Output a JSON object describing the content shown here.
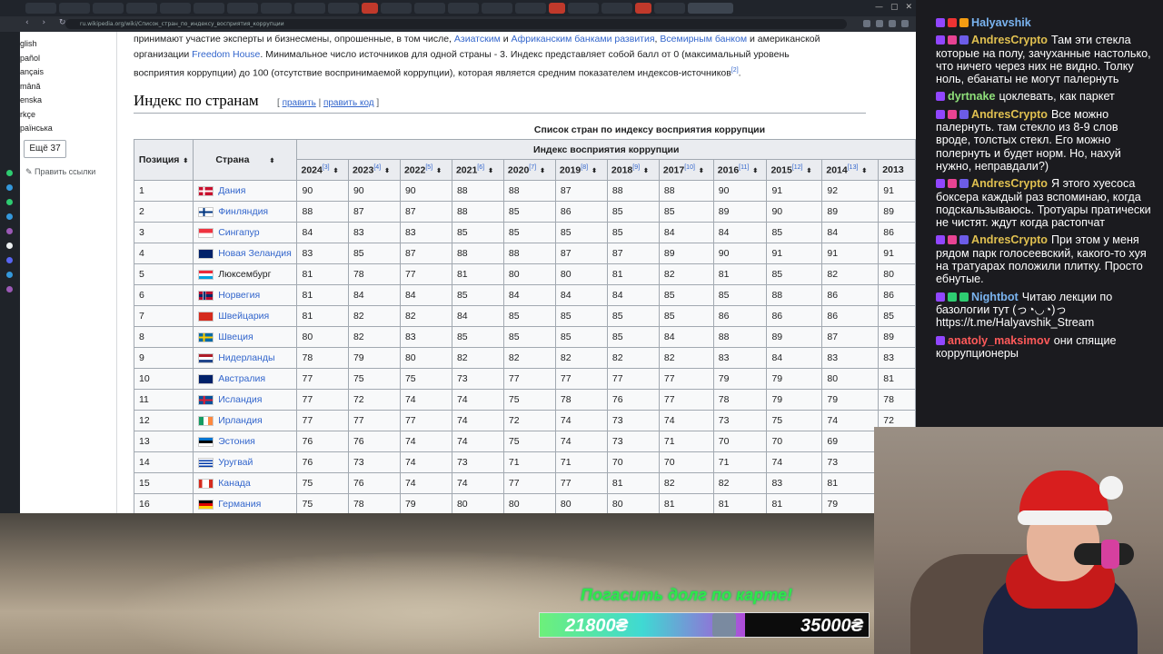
{
  "browser": {
    "url": "ru.wikipedia.org/wiki/Список_стран_по_индексу_восприятия_коррупции",
    "nav_symbols": "‹ › ↻",
    "window_controls": [
      "—",
      "▢",
      "✕"
    ]
  },
  "sidebar": {
    "languages": [
      "glish",
      "pañol",
      "ançais",
      "mână",
      "enska",
      "rkçe",
      "раїнська"
    ],
    "more_button": "Ещё 37",
    "edit_links": "Править ссылки"
  },
  "article": {
    "para_line1_pre": "принимают участие эксперты и бизнесмены, опрошенные, в том числе, ",
    "para_link1": "Азиатским",
    "para_and": " и ",
    "para_link2": "Африканским банками развития",
    "para_comma": ", ",
    "para_link3": "Всемирным банком",
    "para_line1_post": " и американской",
    "para_line2_pre": "организации ",
    "para_link4": "Freedom House",
    "para_line2_post": ". Минимальное число источников для одной страны - 3. Индекс представляет собой балл от 0 (максимальный уровень",
    "para_line3": "восприятия коррупции) до 100 (отсутствие воспринимаемой коррупции), которая является средним показателем индексов-источников",
    "para_ref": "[2]",
    "para_end": ".",
    "heading": "Индекс по странам",
    "edit_open": "[ ",
    "edit_label": "править",
    "edit_sep": " | ",
    "edit_code_label": "править код",
    "edit_close": " ]"
  },
  "table": {
    "caption": "Список стран по индексу восприятия коррупции",
    "col_position": "Позиция",
    "col_country": "Страна",
    "col_group": "Индекс восприятия коррупции",
    "sort_glyph": "⬍",
    "years": [
      {
        "year": "2024",
        "ref": "[3]"
      },
      {
        "year": "2023",
        "ref": "[4]"
      },
      {
        "year": "2022",
        "ref": "[5]"
      },
      {
        "year": "2021",
        "ref": "[6]"
      },
      {
        "year": "2020",
        "ref": "[7]"
      },
      {
        "year": "2019",
        "ref": "[8]"
      },
      {
        "year": "2018",
        "ref": "[9]"
      },
      {
        "year": "2017",
        "ref": "[10]"
      },
      {
        "year": "2016",
        "ref": "[11]"
      },
      {
        "year": "2015",
        "ref": "[12]"
      },
      {
        "year": "2014",
        "ref": "[13]"
      },
      {
        "year": "2013",
        "ref": ""
      }
    ],
    "rows": [
      {
        "pos": "1",
        "country": "Дания",
        "flag": "dk",
        "vals": [
          "90",
          "90",
          "90",
          "88",
          "88",
          "87",
          "88",
          "88",
          "90",
          "91",
          "92",
          "91"
        ]
      },
      {
        "pos": "2",
        "country": "Финляндия",
        "flag": "fi",
        "vals": [
          "88",
          "87",
          "87",
          "88",
          "85",
          "86",
          "85",
          "85",
          "89",
          "90",
          "89",
          "89"
        ]
      },
      {
        "pos": "3",
        "country": "Сингапур",
        "flag": "sg",
        "vals": [
          "84",
          "83",
          "83",
          "85",
          "85",
          "85",
          "85",
          "84",
          "84",
          "85",
          "84",
          "86"
        ]
      },
      {
        "pos": "4",
        "country": "Новая Зеландия",
        "flag": "nz",
        "vals": [
          "83",
          "85",
          "87",
          "88",
          "88",
          "87",
          "87",
          "89",
          "90",
          "91",
          "91",
          "91"
        ]
      },
      {
        "pos": "5",
        "country": "Люксембург",
        "flag": "lu",
        "vals": [
          "81",
          "78",
          "77",
          "81",
          "80",
          "80",
          "81",
          "82",
          "81",
          "85",
          "82",
          "80"
        ]
      },
      {
        "pos": "6",
        "country": "Норвегия",
        "flag": "no",
        "vals": [
          "81",
          "84",
          "84",
          "85",
          "84",
          "84",
          "84",
          "85",
          "85",
          "88",
          "86",
          "86"
        ]
      },
      {
        "pos": "7",
        "country": "Швейцария",
        "flag": "ch",
        "vals": [
          "81",
          "82",
          "82",
          "84",
          "85",
          "85",
          "85",
          "85",
          "86",
          "86",
          "86",
          "85"
        ]
      },
      {
        "pos": "8",
        "country": "Швеция",
        "flag": "se",
        "vals": [
          "80",
          "82",
          "83",
          "85",
          "85",
          "85",
          "85",
          "84",
          "88",
          "89",
          "87",
          "89"
        ]
      },
      {
        "pos": "9",
        "country": "Нидерланды",
        "flag": "nl",
        "vals": [
          "78",
          "79",
          "80",
          "82",
          "82",
          "82",
          "82",
          "82",
          "83",
          "84",
          "83",
          "83"
        ]
      },
      {
        "pos": "10",
        "country": "Австралия",
        "flag": "au",
        "vals": [
          "77",
          "75",
          "75",
          "73",
          "77",
          "77",
          "77",
          "77",
          "79",
          "79",
          "80",
          "81"
        ]
      },
      {
        "pos": "11",
        "country": "Исландия",
        "flag": "is",
        "vals": [
          "77",
          "72",
          "74",
          "74",
          "75",
          "78",
          "76",
          "77",
          "78",
          "79",
          "79",
          "78"
        ]
      },
      {
        "pos": "12",
        "country": "Ирландия",
        "flag": "ie",
        "vals": [
          "77",
          "77",
          "77",
          "74",
          "72",
          "74",
          "73",
          "74",
          "73",
          "75",
          "74",
          "72"
        ]
      },
      {
        "pos": "13",
        "country": "Эстония",
        "flag": "ee",
        "vals": [
          "76",
          "76",
          "74",
          "74",
          "75",
          "74",
          "73",
          "71",
          "70",
          "70",
          "69",
          ""
        ]
      },
      {
        "pos": "14",
        "country": "Уругвай",
        "flag": "uy",
        "vals": [
          "76",
          "73",
          "74",
          "73",
          "71",
          "71",
          "70",
          "70",
          "71",
          "74",
          "73",
          ""
        ]
      },
      {
        "pos": "15",
        "country": "Канада",
        "flag": "ca",
        "vals": [
          "75",
          "76",
          "74",
          "74",
          "77",
          "77",
          "81",
          "82",
          "82",
          "83",
          "81",
          ""
        ]
      },
      {
        "pos": "16",
        "country": "Германия",
        "flag": "de",
        "vals": [
          "75",
          "78",
          "79",
          "80",
          "80",
          "80",
          "80",
          "81",
          "81",
          "81",
          "79",
          ""
        ]
      }
    ]
  },
  "chat": {
    "top_user": "Halyavshik",
    "messages": [
      {
        "user": "AndresCrypto",
        "color": "#e0c050",
        "text": "Там эти стекла которые на полу, зачуханные настолько, что ничего через них не видно. Толку ноль, ебанаты не могут палернуть"
      },
      {
        "user": "dyrtnake",
        "color": "#8fe07a",
        "text": "цоклевать, как паркет"
      },
      {
        "user": "AndresCrypto",
        "color": "#e0c050",
        "text": "Все можно палернуть. там стекло из 8-9 слов вроде, толстых стекл. Его можно полернуть и будет норм. Но, нахуй нужно, неправдали?)"
      },
      {
        "user": "AndresCrypto",
        "color": "#e0c050",
        "text": "Я этого хуесоса боксера каждый раз вспоминаю, когда подскальзываюсь. Тротуары пратически не чистят. ждут когда растопчат"
      },
      {
        "user": "AndresCrypto",
        "color": "#e0c050",
        "text": "При этом у меня рядом парк голосеевский, какого-то хуя на тратуарах положили плитку. Просто ебнутые."
      },
      {
        "user": "Nightbot",
        "color": "#7ab4f0",
        "text": "Читаю лекции по базологии тут (っ◔◡◔)っ https://t.me/Halyavshik_Stream"
      },
      {
        "user": "anatoly_maksimov",
        "color": "#ff5a5a",
        "text": "они спящие коррупционеры"
      }
    ]
  },
  "overlay": {
    "goal_title": "Погасить долг по карте!",
    "goal_current": "21800₴",
    "goal_target": "35000₴",
    "goal_progress": 0.623
  },
  "colors": {
    "link": "#3366cc",
    "table_header": "#eaecf0",
    "goal_text": "#2ee84a"
  }
}
